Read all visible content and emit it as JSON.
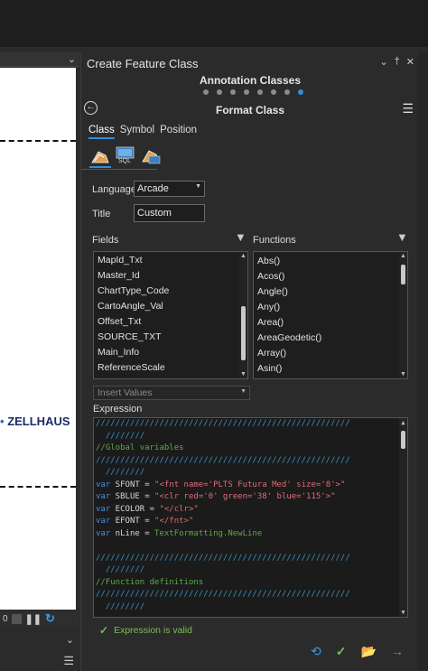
{
  "map": {
    "label": "ZELLHAUS",
    "status_value": "0"
  },
  "panel": {
    "title": "Create Feature Class",
    "section_title": "Annotation Classes",
    "page_title": "Format Class",
    "steps_total": 8,
    "step_active": 8,
    "tabs": [
      "Class",
      "Symbol",
      "Position"
    ],
    "active_tab": "Class",
    "mode_icons": [
      "label-expression-icon",
      "sql-icon",
      "label-class-icon"
    ],
    "sql_text": "SQL",
    "language_label": "Language",
    "language_value": "Arcade",
    "title_label": "Title",
    "title_value": "Custom",
    "fields_label": "Fields",
    "functions_label": "Functions",
    "fields": [
      "MapId_Txt",
      "Master_Id",
      "ChartType_Code",
      "CartoAngle_Val",
      "Offset_Txt",
      "SOURCE_TXT",
      "Main_Info",
      "ReferenceScale"
    ],
    "functions": [
      "Abs()",
      "Acos()",
      "Angle()",
      "Any()",
      "Area()",
      "AreaGeodetic()",
      "Array()",
      "Asin()"
    ],
    "insert_values_placeholder": "Insert Values",
    "expression_label": "Expression",
    "expression_lines": [
      {
        "t": "////////////////////////////////////////////////////",
        "c": "c-sl"
      },
      {
        "t": "  ////////",
        "c": "c-sl"
      },
      {
        "t": "//Global variables",
        "c": "c-cm"
      },
      {
        "t": "////////////////////////////////////////////////////",
        "c": "c-sl"
      },
      {
        "t": "  ////////",
        "c": "c-sl"
      },
      {
        "kw": "var",
        "name": " SFONT",
        "op": " = ",
        "str": "\"<fnt name='PLTS Futura Med' size='8'>\""
      },
      {
        "kw": "var",
        "name": " SBLUE",
        "op": " = ",
        "str": "\"<clr red='0' green='38' blue='115'>\""
      },
      {
        "kw": "var",
        "name": " ECOLOR",
        "op": " = ",
        "str": "\"</clr>\""
      },
      {
        "kw": "var",
        "name": " EFONT",
        "op": " = ",
        "str": "\"</fnt>\""
      },
      {
        "kw": "var",
        "name": " nLine",
        "op": " = ",
        "fn": "TextFormatting.NewLine"
      },
      {
        "t": "",
        "c": "c-var"
      },
      {
        "t": "////////////////////////////////////////////////////",
        "c": "c-sl"
      },
      {
        "t": "  ////////",
        "c": "c-sl"
      },
      {
        "t": "//Function definitions",
        "c": "c-cm"
      },
      {
        "t": "////////////////////////////////////////////////////",
        "c": "c-sl"
      },
      {
        "t": "  ////////",
        "c": "c-sl"
      }
    ],
    "validation_message": "Expression is valid",
    "accent_color": "#2f8fd8",
    "valid_color": "#7dbd5a"
  }
}
